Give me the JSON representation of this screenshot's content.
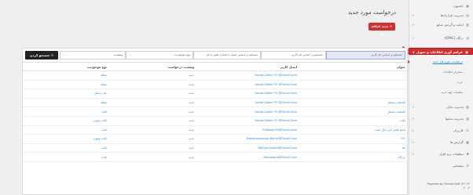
{
  "page": {
    "title": "درخواست مورد جدید",
    "add_button": "جدید اضافه کن"
  },
  "sidebar": {
    "items": [
      {
        "label": "داشبورد",
        "icon": "dashboard-icon",
        "chevron": ""
      },
      {
        "label": "مدیریت قراردادها",
        "icon": "contract-icon",
        "chevron": "<"
      },
      {
        "label": "امانت و گردش منابع",
        "icon": "book-icon",
        "chevron": "<"
      },
      {
        "label": "درگاه (OPAC)",
        "icon": "globe-icon",
        "chevron": "<"
      },
      {
        "label": "فراهم آوری اطلاعات و تحویل مدرک",
        "icon": "box-icon",
        "chevron": "v"
      }
    ],
    "subitems": [
      {
        "label": "درخواست مورد های جدید"
      },
      {
        "label": "سفارش اطلاعات"
      },
      {
        "label": "خرید"
      },
      {
        "label": "تنظیمات تهیه خرید"
      }
    ],
    "lower_items": [
      {
        "label": "مدیریت مالی",
        "icon": "money-icon",
        "chevron": "<"
      },
      {
        "label": "مدیریت محتوا",
        "icon": "file-icon",
        "chevron": "<"
      },
      {
        "label": "کاربران",
        "icon": "user-icon",
        "chevron": "<"
      },
      {
        "label": "گزارش ها",
        "icon": "chart-icon",
        "chevron": "<"
      },
      {
        "label": "تنظیمات نرم افزار",
        "icon": "settings-icon",
        "chevron": "<"
      },
      {
        "label": "پشتیبانی",
        "icon": "support-icon",
        "chevron": ""
      }
    ],
    "footer_line1": "Powered by ParsianSoft ©۲۰۲۳",
    "footer_line2": "۲.۰.۳"
  },
  "filters": {
    "search_title_placeholder": "جستجو بر اساس نام کاربر",
    "search_email_placeholder": "جستجو بر اساس ایمیل یا شماره تلفن یا نام",
    "type_placeholder": "نوع موجودیت",
    "status_placeholder": "وضعیت",
    "search_button": "جستجو کردن"
  },
  "table": {
    "headers": [
      "عنوان",
      "ایمیل کاربر",
      "وضعیت درخواست",
      "نوع موجودیت"
    ],
    "rows": [
      {
        "title": "",
        "email": "Sarasi.Zaker۱۹۹۰@Gmail.Com",
        "status": "جدید",
        "type": "مقاله"
      },
      {
        "title": "",
        "email": "Sarasi.Zaker۱۹۹۰@Gmail.Com",
        "status": "جدید",
        "type": "مقاله"
      },
      {
        "title": "",
        "email": "Sarasi.Zaker۱۹۹۰@Gmail.Com",
        "status": "جدید",
        "type": "چاپ سنگی"
      },
      {
        "title": "کتابخانه دیجیتال",
        "email": "Sarasi.Zaker۱۹۹۰@Gmail.Com",
        "status": "جدید",
        "type": "مقاله"
      },
      {
        "title": "کتابخانه دیجیتال",
        "email": "Sarasi.Zaker۱۹۹۰@Gmail.Com",
        "status": "جدید",
        "type": "کتاب"
      },
      {
        "title": "کتاب",
        "email": "Sarasi.Zaker۱۹۹۰@Gmail.Com",
        "status": "جدید",
        "type": "کتاب صوتی"
      },
      {
        "title": "پاسخ فصل آخر سال است",
        "email": "F.Mohsen۹۳@Gmail.Com",
        "status": "جدید",
        "type": "کتاب"
      },
      {
        "title": "۲۲۲",
        "email": "Mohammadreza.Bon۹۸@Gmail.Com",
        "status": "جدید",
        "type": "کتاب صوتی"
      },
      {
        "title": "ملا",
        "email": "Mahyar.Sohani@Gmail.Com",
        "status": "جدید",
        "type": "کتاب"
      },
      {
        "title": "بزرگان",
        "email": "Zsimaban۸@Gmail.Com",
        "status": "جدید",
        "type": "کتاب"
      }
    ]
  },
  "colors": {
    "accent_red": "#d32f2f",
    "link_blue": "#1e88e5",
    "search_dark": "#222222"
  }
}
